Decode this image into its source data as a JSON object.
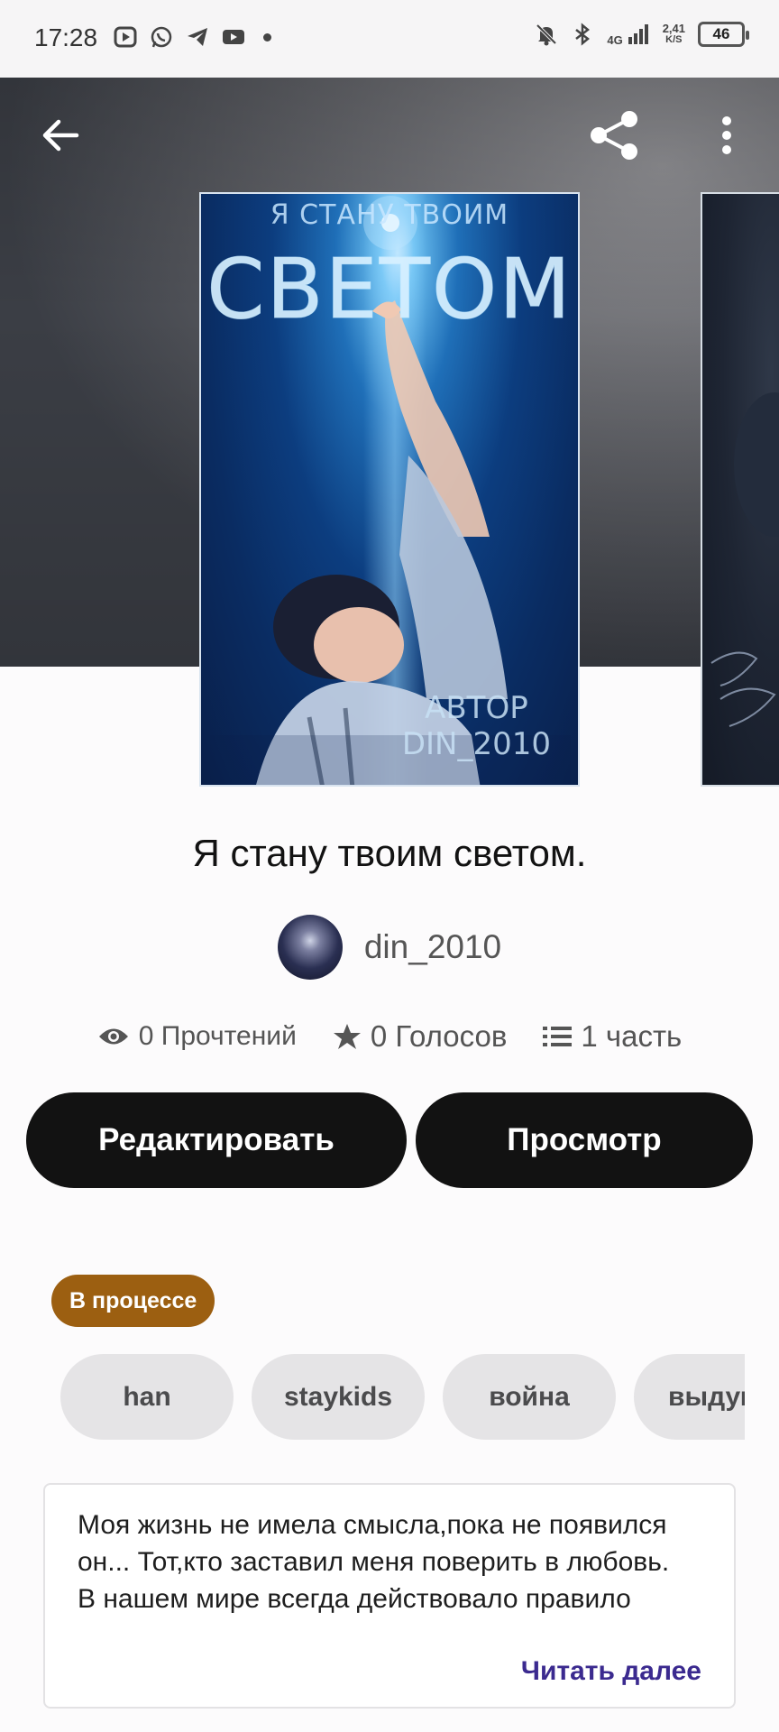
{
  "status_bar": {
    "time": "17:28",
    "network_type": "4G",
    "speed_value": "2,41",
    "speed_unit": "K/S",
    "battery": "46",
    "left_icons": [
      "play-icon",
      "whatsapp-icon",
      "telegram-icon",
      "youtube-icon",
      "dot-icon"
    ],
    "right_icons": [
      "mute-icon",
      "bluetooth-icon",
      "signal-icon",
      "battery-icon"
    ]
  },
  "header": {
    "back_icon": "arrow-left-icon",
    "share_icon": "share-icon",
    "menu_icon": "more-vertical-icon"
  },
  "cover": {
    "top_text": "Я СТАНУ ТВОИМ",
    "title_text": "СВЕТОМ",
    "author_line1": "АВТОР",
    "author_line2": "DIN_2010"
  },
  "story": {
    "title": "Я стану твоим светом.",
    "author": "din_2010"
  },
  "stats": {
    "reads": "0 Прочтений",
    "votes": "0 Голосов",
    "parts": "1 часть"
  },
  "buttons": {
    "edit": "Редактировать",
    "view": "Просмотр"
  },
  "status_badge": "В процессе",
  "tags": [
    "han",
    "staykids",
    "война",
    "выдуманная"
  ],
  "description": {
    "text": "Моя жизнь не имела смысла,пока не появился он... Тот,кто заставил меня поверить в любовь.\nВ нашем мире всегда действовало правило",
    "read_more": "Читать далее"
  },
  "colors": {
    "badge": "#9c5f11",
    "button_bg": "#121212",
    "read_more": "#3b2a8f",
    "tag_bg": "#e5e4e6"
  }
}
